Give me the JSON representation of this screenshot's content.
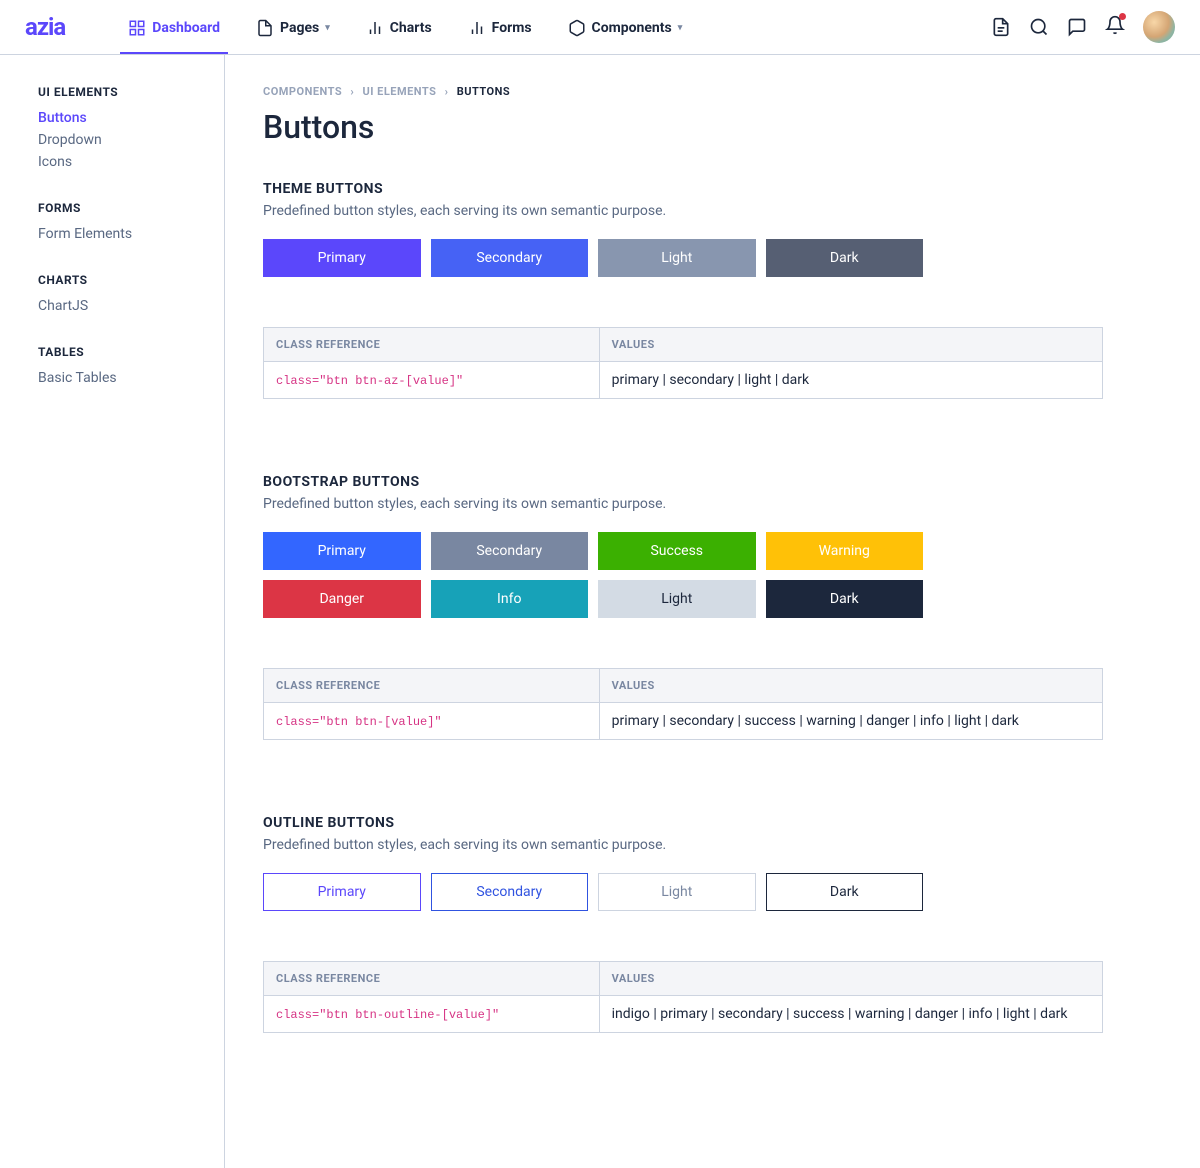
{
  "brand": "azia",
  "nav": [
    {
      "label": "Dashboard",
      "icon": "dash",
      "active": true
    },
    {
      "label": "Pages",
      "icon": "file",
      "dropdown": true
    },
    {
      "label": "Charts",
      "icon": "chart"
    },
    {
      "label": "Forms",
      "icon": "chart"
    },
    {
      "label": "Components",
      "icon": "box",
      "dropdown": true
    }
  ],
  "sidebar": [
    {
      "title": "UI ELEMENTS",
      "items": [
        {
          "label": "Buttons",
          "active": true
        },
        {
          "label": "Dropdown"
        },
        {
          "label": "Icons"
        }
      ]
    },
    {
      "title": "FORMS",
      "items": [
        {
          "label": "Form Elements"
        }
      ]
    },
    {
      "title": "CHARTS",
      "items": [
        {
          "label": "ChartJS"
        }
      ]
    },
    {
      "title": "TABLES",
      "items": [
        {
          "label": "Basic Tables"
        }
      ]
    }
  ],
  "breadcrumb": [
    "COMPONENTS",
    "UI ELEMENTS",
    "BUTTONS"
  ],
  "page_title": "Buttons",
  "sections": {
    "theme": {
      "title": "THEME BUTTONS",
      "text": "Predefined button styles, each serving its own semantic purpose.",
      "buttons": [
        {
          "label": "Primary",
          "cls": "btn-az-primary"
        },
        {
          "label": "Secondary",
          "cls": "btn-az-secondary"
        },
        {
          "label": "Light",
          "cls": "btn-az-light"
        },
        {
          "label": "Dark",
          "cls": "btn-az-dark"
        }
      ],
      "ref_header": [
        "CLASS REFERENCE",
        "VALUES"
      ],
      "ref_code": "class=\"btn btn-az-[value]\"",
      "ref_values": "primary | secondary | light | dark"
    },
    "bootstrap": {
      "title": "BOOTSTRAP BUTTONS",
      "text": "Predefined button styles, each serving its own semantic purpose.",
      "buttons": [
        {
          "label": "Primary",
          "cls": "btn-primary"
        },
        {
          "label": "Secondary",
          "cls": "btn-secondary"
        },
        {
          "label": "Success",
          "cls": "btn-success"
        },
        {
          "label": "Warning",
          "cls": "btn-warning"
        },
        {
          "label": "Danger",
          "cls": "btn-danger"
        },
        {
          "label": "Info",
          "cls": "btn-info"
        },
        {
          "label": "Light",
          "cls": "btn-light"
        },
        {
          "label": "Dark",
          "cls": "btn-dark"
        }
      ],
      "ref_header": [
        "CLASS REFERENCE",
        "VALUES"
      ],
      "ref_code": "class=\"btn btn-[value]\"",
      "ref_values": "primary | secondary | success | warning | danger | info | light | dark"
    },
    "outline": {
      "title": "OUTLINE BUTTONS",
      "text": "Predefined button styles, each serving its own semantic purpose.",
      "buttons": [
        {
          "label": "Primary",
          "cls": "btn-outline-primary"
        },
        {
          "label": "Secondary",
          "cls": "btn-outline-secondary"
        },
        {
          "label": "Light",
          "cls": "btn-outline-light"
        },
        {
          "label": "Dark",
          "cls": "btn-outline-dark"
        }
      ],
      "ref_header": [
        "CLASS REFERENCE",
        "VALUES"
      ],
      "ref_code": "class=\"btn btn-outline-[value]\"",
      "ref_values": "indigo | primary | secondary | success | warning | danger | info | light | dark"
    }
  }
}
